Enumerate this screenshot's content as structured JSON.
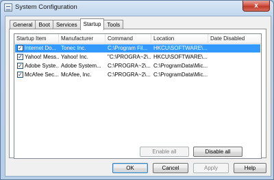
{
  "window": {
    "title": "System Configuration",
    "close_glyph": "x"
  },
  "tabs": [
    {
      "label": "General"
    },
    {
      "label": "Boot"
    },
    {
      "label": "Services"
    },
    {
      "label": "Startup"
    },
    {
      "label": "Tools"
    }
  ],
  "active_tab": "Startup",
  "table": {
    "columns": [
      "Startup Item",
      "Manufacturer",
      "Command",
      "Location",
      "Date Disabled"
    ],
    "rows": [
      {
        "item": "Internet Do...",
        "manufacturer": "Tonec Inc.",
        "command": "C:\\Program Fil...",
        "location": "HKCU\\SOFTWARE\\...",
        "date_disabled": "",
        "checked": true,
        "selected": true
      },
      {
        "item": "Yahoo! Mess...",
        "manufacturer": "Yahoo! Inc.",
        "command": "\"C:\\PROGRA~2\\...",
        "location": "HKCU\\SOFTWARE\\...",
        "date_disabled": "",
        "checked": true,
        "selected": false
      },
      {
        "item": "Adobe Syste...",
        "manufacturer": "Adobe System...",
        "command": "C:\\PROGRA~2\\...",
        "location": "C:\\ProgramData\\Mic...",
        "date_disabled": "",
        "checked": true,
        "selected": false
      },
      {
        "item": "McAfee Sec...",
        "manufacturer": "McAfee, Inc.",
        "command": "C:\\PROGRA~2\\...",
        "location": "C:\\ProgramData\\Mic...",
        "date_disabled": "",
        "checked": true,
        "selected": false
      }
    ]
  },
  "buttons": {
    "enable_all": "Enable all",
    "disable_all": "Disable all",
    "ok": "OK",
    "cancel": "Cancel",
    "apply": "Apply",
    "help": "Help"
  },
  "checkbox_glyph": "✓"
}
